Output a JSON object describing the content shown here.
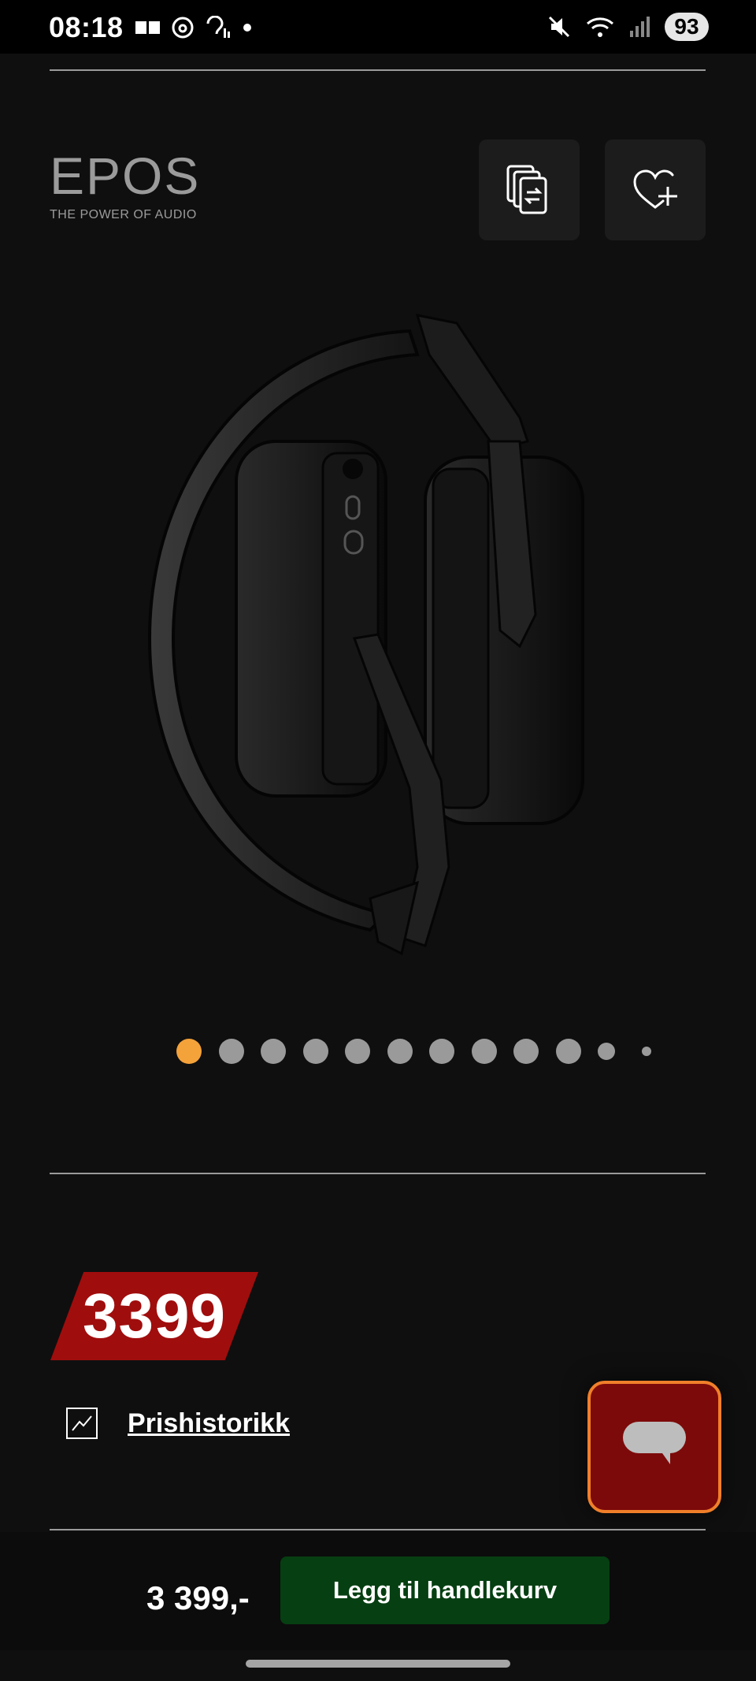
{
  "status_bar": {
    "time": "08:18",
    "battery": "93",
    "icons_left": [
      "news-icon",
      "threads-icon",
      "hearing-icon",
      "dot-icon"
    ],
    "icons_right": [
      "mute-icon",
      "wifi-icon",
      "signal-icon"
    ]
  },
  "brand": {
    "name": "EPOS",
    "tagline": "THE POWER OF AUDIO"
  },
  "actions": {
    "compare_icon": "compare-icon",
    "wishlist_icon": "heart-plus-icon"
  },
  "gallery": {
    "total_images": 12,
    "active_index": 0
  },
  "price": {
    "badge": "3399",
    "history_label": "Prishistorikk"
  },
  "bottom_bar": {
    "price": "3 399,-",
    "add_to_cart": "Legg til handlekurv"
  },
  "colors": {
    "background": "#0f0f0f",
    "accent_orange": "#f4a23a",
    "price_red": "#a00d0d",
    "cart_green": "#063f12",
    "chat_border": "#f07f2a"
  }
}
